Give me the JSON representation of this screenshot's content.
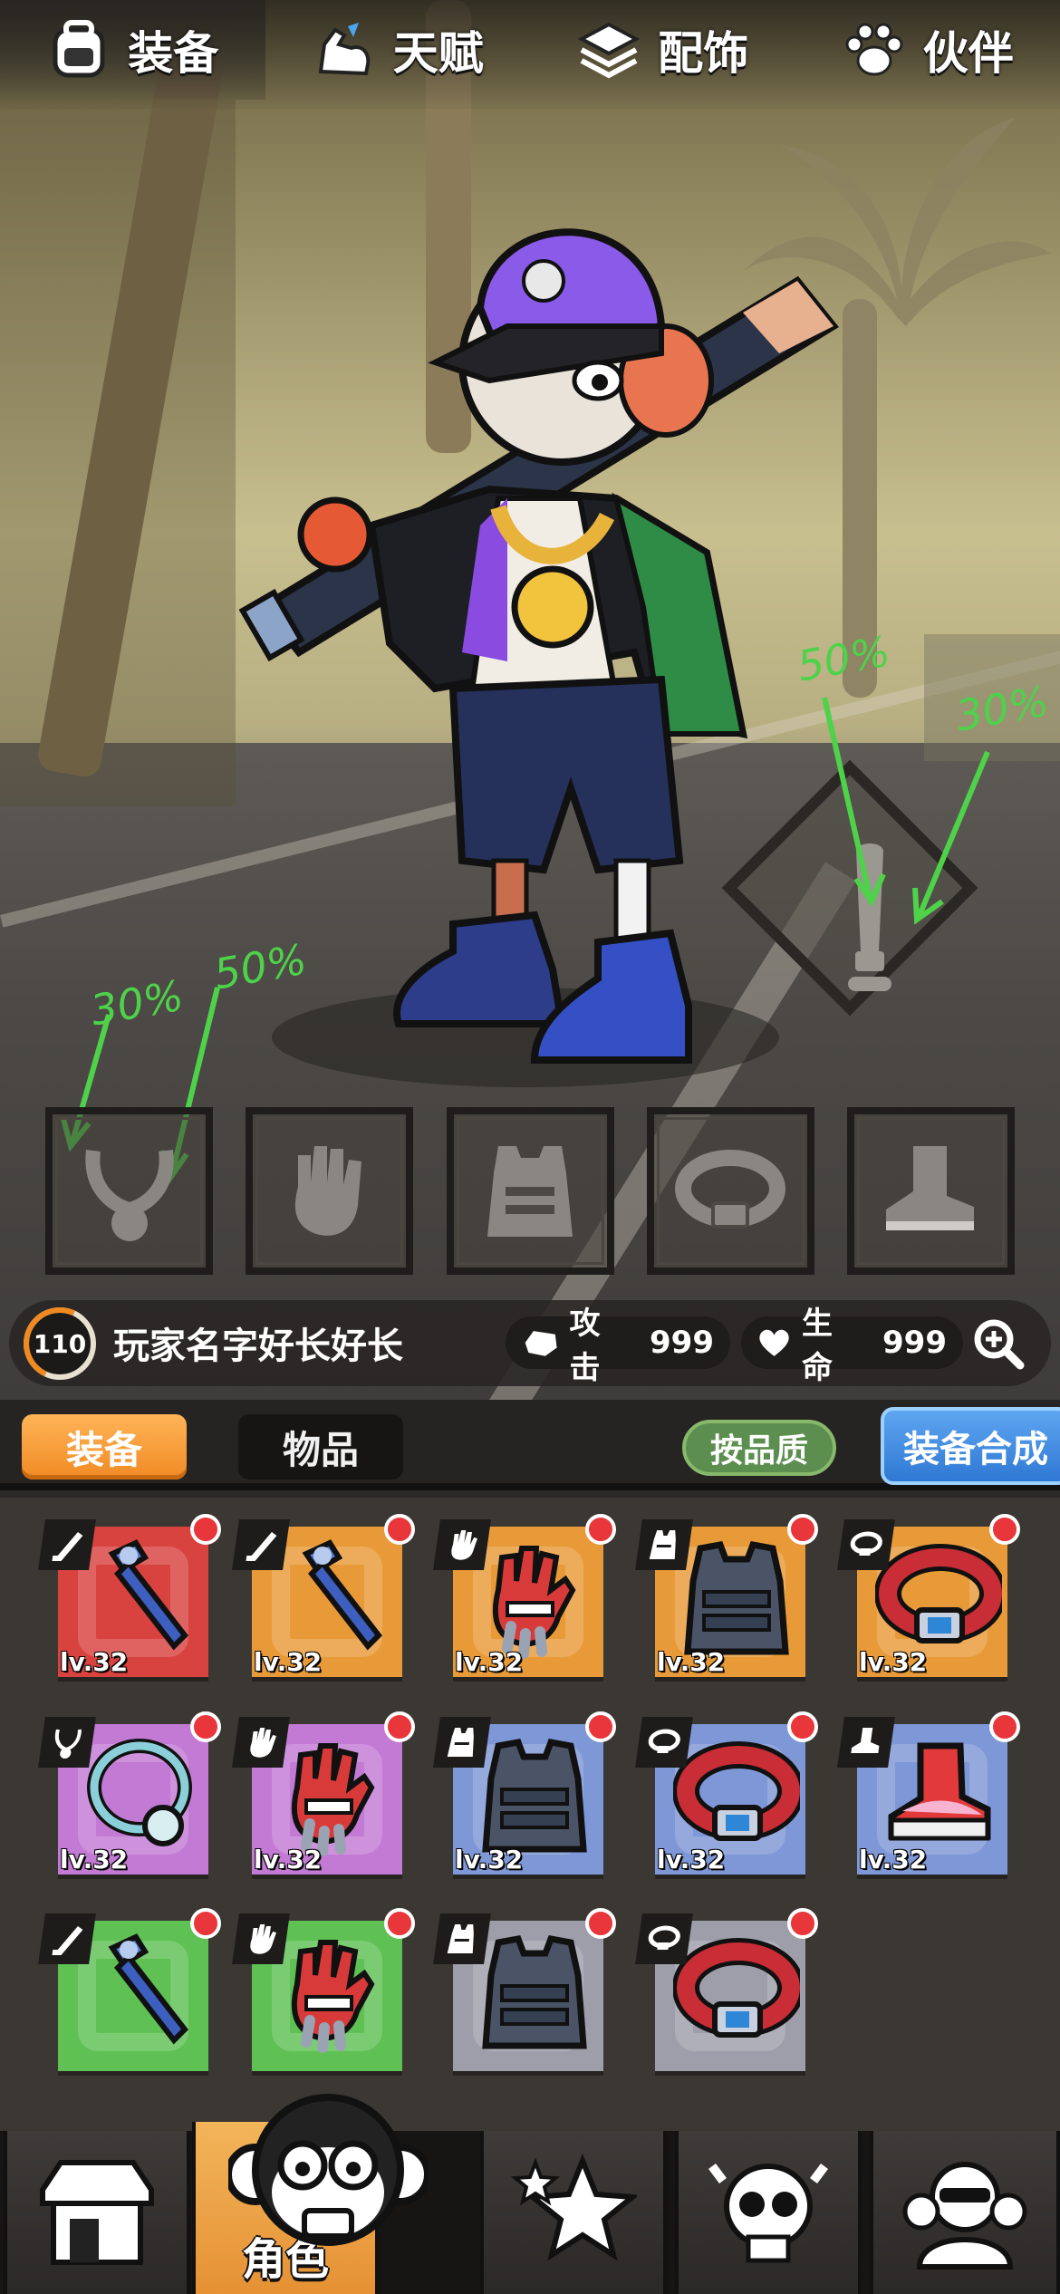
{
  "top_tabs": [
    {
      "label": "装备",
      "icon": "backpack-icon",
      "active": true
    },
    {
      "label": "天赋",
      "icon": "muscle-arm-icon",
      "active": false
    },
    {
      "label": "配饰",
      "icon": "layers-icon",
      "active": false
    },
    {
      "label": "伙伴",
      "icon": "paw-icon",
      "active": false
    }
  ],
  "annotations": {
    "weapon_left": "50%",
    "weapon_right": "30%",
    "necklace_left": "30%",
    "necklace_right": "50%"
  },
  "equip_slots": [
    "necklace-slot-icon",
    "glove-slot-icon",
    "vest-slot-icon",
    "belt-slot-icon",
    "shoe-slot-icon"
  ],
  "player": {
    "level": "110",
    "name": "玩家名字好长好长",
    "attack_label": "攻击",
    "attack_value": "999",
    "hp_label": "生命",
    "hp_value": "999"
  },
  "filter": {
    "tab_equip": "装备",
    "tab_items": "物品",
    "quality_button": "按品质",
    "synth_button": "装备合成"
  },
  "inventory": [
    {
      "type": "bat",
      "quality": "red",
      "level": "lv.32"
    },
    {
      "type": "bat",
      "quality": "orange",
      "level": "lv.32"
    },
    {
      "type": "glove",
      "quality": "orange",
      "level": "lv.32"
    },
    {
      "type": "vest",
      "quality": "orange",
      "level": "lv.32"
    },
    {
      "type": "belt",
      "quality": "orange",
      "level": "lv.32"
    },
    {
      "type": "necklace",
      "quality": "purple",
      "level": "lv.32"
    },
    {
      "type": "glove",
      "quality": "purple",
      "level": "lv.32"
    },
    {
      "type": "vest",
      "quality": "blue",
      "level": "lv.32"
    },
    {
      "type": "belt",
      "quality": "blue",
      "level": "lv.32"
    },
    {
      "type": "shoe",
      "quality": "blue",
      "level": "lv.32"
    },
    {
      "type": "bat",
      "quality": "green",
      "level": ""
    },
    {
      "type": "glove",
      "quality": "green",
      "level": ""
    },
    {
      "type": "vest",
      "quality": "grey",
      "level": ""
    },
    {
      "type": "belt",
      "quality": "grey",
      "level": ""
    }
  ],
  "bottom_nav": [
    {
      "icon": "shop-icon",
      "label": ""
    },
    {
      "icon": "monkey-character-icon",
      "label": "角色",
      "active": true
    },
    {
      "icon": "stars-icon",
      "label": ""
    },
    {
      "icon": "skull-icon",
      "label": ""
    },
    {
      "icon": "monkey-squad-icon",
      "label": ""
    }
  ],
  "colors": {
    "accent_orange": "#f08a24",
    "synth_blue": "#2f78d4",
    "quality_green_button": "#5c8f4f",
    "annotation_green": "#4ed24a",
    "red_dot": "#e8363b"
  }
}
